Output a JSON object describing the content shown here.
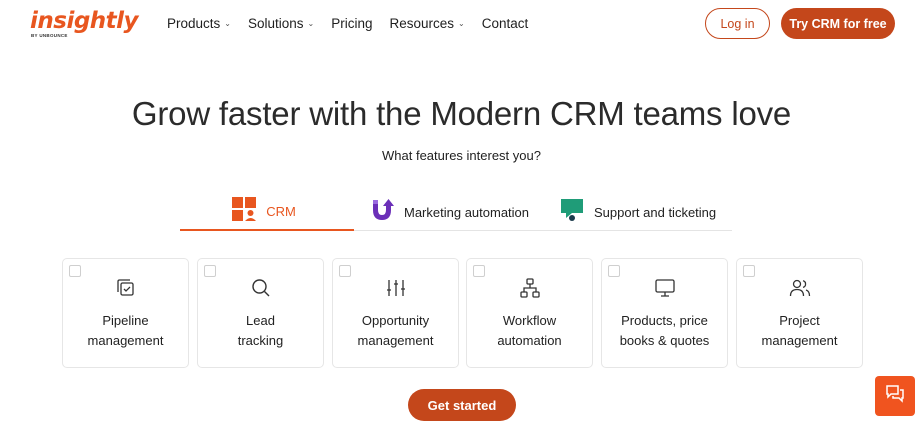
{
  "header": {
    "logo": {
      "word": "insightly",
      "sub": "BY UNBOUNCE"
    },
    "nav": [
      {
        "label": "Products",
        "has_dropdown": true
      },
      {
        "label": "Solutions",
        "has_dropdown": true
      },
      {
        "label": "Pricing",
        "has_dropdown": false
      },
      {
        "label": "Resources",
        "has_dropdown": true
      },
      {
        "label": "Contact",
        "has_dropdown": false
      }
    ],
    "login_label": "Log in",
    "try_label": "Try CRM for free"
  },
  "hero": {
    "title": "Grow faster with the Modern CRM teams love",
    "subtitle": "What features interest you?"
  },
  "tabs": [
    {
      "label": "CRM",
      "icon": "crm-grid-icon",
      "active": true
    },
    {
      "label": "Marketing automation",
      "icon": "marketing-arrow-icon",
      "active": false
    },
    {
      "label": "Support and ticketing",
      "icon": "support-ticket-icon",
      "active": false
    }
  ],
  "cards": [
    {
      "line1": "Pipeline",
      "line2": "management",
      "icon": "pipeline-icon",
      "checked": false
    },
    {
      "line1": "Lead",
      "line2": "tracking",
      "icon": "search-icon",
      "checked": false
    },
    {
      "line1": "Opportunity",
      "line2": "management",
      "icon": "sliders-icon",
      "checked": false
    },
    {
      "line1": "Workflow",
      "line2": "automation",
      "icon": "workflow-icon",
      "checked": false
    },
    {
      "line1": "Products, price",
      "line2": "books & quotes",
      "icon": "monitor-icon",
      "checked": false
    },
    {
      "line1": "Project",
      "line2": "management",
      "icon": "users-icon",
      "checked": false
    }
  ],
  "cta_label": "Get started",
  "colors": {
    "brand": "#e8561f",
    "button": "#c4471b",
    "marketing_icon": "#6b2fb8",
    "support_icon": "#1f9c78"
  }
}
